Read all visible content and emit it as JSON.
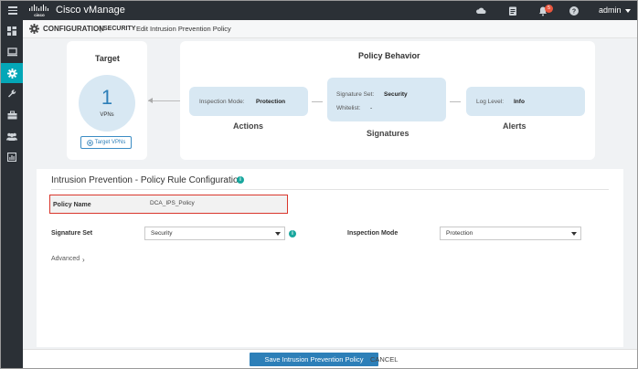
{
  "app": {
    "title": "Cisco vManage",
    "user": "admin",
    "notification_count": "5"
  },
  "topbar": {
    "icons": [
      "cloud-icon",
      "tasks-icon",
      "bell-icon",
      "help-icon"
    ]
  },
  "sidebar": {
    "items": [
      {
        "icon": "dashboard-icon"
      },
      {
        "icon": "monitor-icon"
      },
      {
        "icon": "configuration-gear-icon",
        "active": true
      },
      {
        "icon": "tools-wrench-icon"
      },
      {
        "icon": "maintenance-toolbox-icon"
      },
      {
        "icon": "administration-users-icon"
      },
      {
        "icon": "analytics-icon"
      }
    ]
  },
  "header": {
    "section": "CONFIGURATION",
    "separator": "|",
    "subsection": "SECURITY",
    "page": "Edit Intrusion Prevention Policy"
  },
  "target": {
    "title": "Target",
    "count": "1",
    "unit": "VPNs",
    "button_label": "Target VPNs"
  },
  "behavior": {
    "title": "Policy Behavior",
    "actions": {
      "label": "Inspection Mode:",
      "value": "Protection",
      "caption": "Actions"
    },
    "signatures": {
      "set_label": "Signature Set:",
      "set_value": "Security",
      "whitelist_label": "Whitelist:",
      "whitelist_value": "-",
      "caption": "Signatures"
    },
    "alerts": {
      "label": "Log Level:",
      "value": "Info",
      "caption": "Alerts"
    }
  },
  "config": {
    "title": "Intrusion Prevention - Policy Rule Configuration",
    "policy_name_label": "Policy Name",
    "policy_name_value": "DCA_IPS_Policy",
    "signature_set_label": "Signature Set",
    "signature_set_value": "Security",
    "inspection_mode_label": "Inspection Mode",
    "inspection_mode_value": "Protection",
    "advanced_label": "Advanced"
  },
  "footer": {
    "save_label": "Save Intrusion Prevention Policy",
    "cancel_label": "CANCEL"
  },
  "colors": {
    "topbar": "#2b3036",
    "active_nav": "#04a7b7",
    "primary_button": "#2d7fb8",
    "highlight_border": "#d9362c",
    "card_fill": "#d8e8f3"
  }
}
